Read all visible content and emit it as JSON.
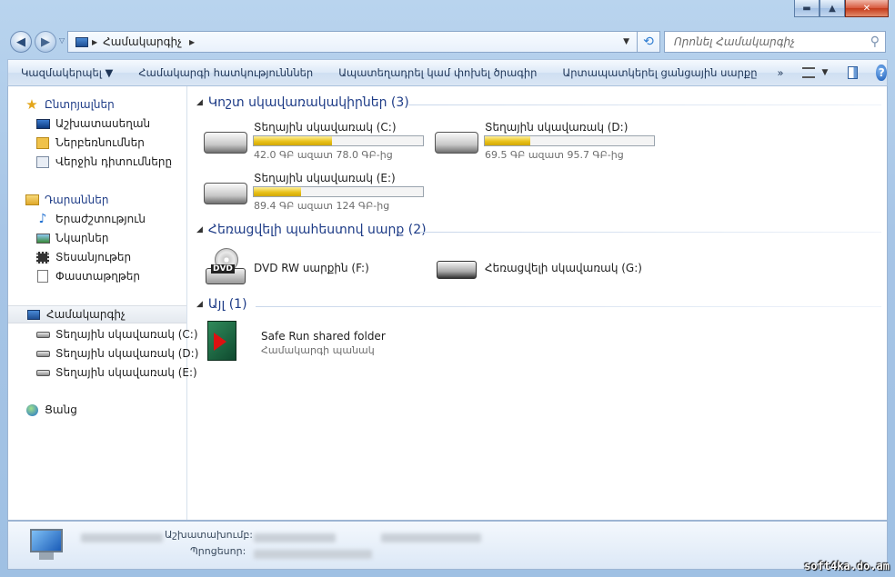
{
  "window": {
    "min_label": "▬",
    "max_label": "▲",
    "close_label": "✕"
  },
  "address": {
    "crumb": "Համակարգիչ",
    "sep1": "▶",
    "sep2": "▶",
    "dropdown": "▼",
    "refresh": "⟲"
  },
  "search": {
    "placeholder": "Որոնել Համակարգիչ",
    "icon": "search-icon"
  },
  "toolbar": {
    "organize": "Կազմակերպել ▼",
    "system_properties": "Համակարգի հատկությունններ",
    "uninstall": "Ապատեղադրել կամ փոխել ծրագիր",
    "map_drive": "Արտապատկերել ցանցային սարքը",
    "more": "»",
    "view": "▼",
    "help": "?"
  },
  "nav": {
    "favorites": "Ընտրյալներ",
    "desktop": "Աշխատասեղան",
    "downloads": "Ներբեռնումներ",
    "recent": "Վերջին դիտումները",
    "libraries": "Դարաններ",
    "music": "Երաժշտություն",
    "pictures": "Նկարներ",
    "videos": "Տեսանյութեր",
    "documents": "Փաստաթղթեր",
    "computer": "Համակարգիչ",
    "drive_c": "Տեղային սկավառակ (C:)",
    "drive_d": "Տեղային սկավառակ (D:)",
    "drive_e": "Տեղային սկավառակ (E:)",
    "network": "Ցանց"
  },
  "groups": {
    "hdd": "Կոշտ սկավառակակիրներ (3)",
    "removable": "Հեռացվելի պահեստով սարք (2)",
    "other": "Այլ (1)"
  },
  "drives": [
    {
      "name": "Տեղային սկավառակ (C:)",
      "free": "42.0 ԳԲ ազատ 78.0 ԳԲ-ից",
      "used_fraction": 0.46
    },
    {
      "name": "Տեղային սկավառակ (D:)",
      "free": "69.5 ԳԲ ազատ 95.7 ԳԲ-ից",
      "used_fraction": 0.27
    },
    {
      "name": "Տեղային սկավառակ (E:)",
      "free": "89.4 ԳԲ ազատ 124 ԳԲ-ից",
      "used_fraction": 0.28
    }
  ],
  "removable": {
    "dvd": "DVD RW սարքին (F:)",
    "dvd_badge": "DVD",
    "usb": "Հեռացվելի սկավառակ (G:)"
  },
  "other_item": {
    "name": "Safe Run shared folder",
    "type": "Համակարգի պանակ"
  },
  "details": {
    "workgroup_label": "Աշխատախումբ:",
    "processor_label": "Պրոցեսոր:"
  },
  "watermark": "soft4ka.do.am",
  "colors": {
    "accent": "#1e3c87",
    "bar": "#e9c21c"
  }
}
